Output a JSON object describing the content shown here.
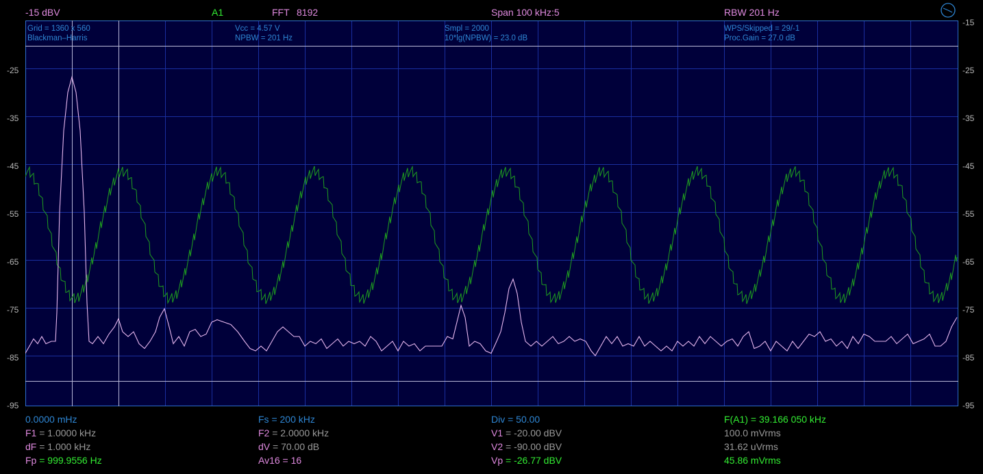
{
  "header": {
    "ref_level": "-15 dBV",
    "channel": "A1",
    "fft_label": "FFT",
    "fft_size": "8192",
    "span": "Span 100 kHz:5",
    "rbw": "RBW 201 Hz"
  },
  "info": {
    "grid": "Grid = 1360 x 560",
    "window": "Blackman–Harris",
    "vcc": "Vcc = 4.57 V",
    "npbw": "NPBW = 201 Hz",
    "smpl": "Smpl = 2000",
    "lg_npbw": "10*lg(NPBW) = 23.0 dB",
    "wps": "WPS/Skipped  = 29/-1",
    "proc_gain": "Proc.Gain = 27.0 dB"
  },
  "y_axis": {
    "left_labels": [
      "-25",
      "-35",
      "-45",
      "-55",
      "-65",
      "-75",
      "-85",
      "-95"
    ],
    "right_labels": [
      "-15",
      "-25",
      "-35",
      "-45",
      "-55",
      "-65",
      "-75",
      "-85",
      "-95"
    ]
  },
  "readouts": {
    "col1": [
      {
        "label": "",
        "value": "0.0000 mHz"
      },
      {
        "label": "F1",
        "value": " = 1.0000 kHz"
      },
      {
        "label": "dF",
        "value": " = 1.000 kHz"
      },
      {
        "label": "Fp",
        "value": " = 999.9556 Hz"
      }
    ],
    "col2": [
      {
        "label": "Fs = 200 kHz",
        "value": ""
      },
      {
        "label": "F2",
        "value": " = 2.0000 kHz"
      },
      {
        "label": "dV",
        "value": " = 70.00 dB"
      },
      {
        "label": "Av16",
        "value": " = 16"
      }
    ],
    "col3": [
      {
        "label": "Div = 50.00",
        "value": ""
      },
      {
        "label": "V1",
        "value": " = -20.00 dBV"
      },
      {
        "label": "V2",
        "value": " = -90.00 dBV"
      },
      {
        "label": "Vp",
        "value": " = -26.77 dBV"
      }
    ],
    "col4": [
      {
        "label": "F(A1) = 39.166 050 kHz",
        "value": ""
      },
      {
        "label": "100.0 mVrms",
        "value": ""
      },
      {
        "label": "31.62 uVrms",
        "value": ""
      },
      {
        "label": "45.86 mVrms",
        "value": ""
      }
    ]
  },
  "colors": {
    "grid_line": "#1a2fa0",
    "plot_bg": "#00003a",
    "spectrum": "#e8b8f0",
    "waveform": "#1fa01f",
    "cursor": "#b8b8d8"
  },
  "icons": {
    "top_right": "clock-icon"
  }
}
